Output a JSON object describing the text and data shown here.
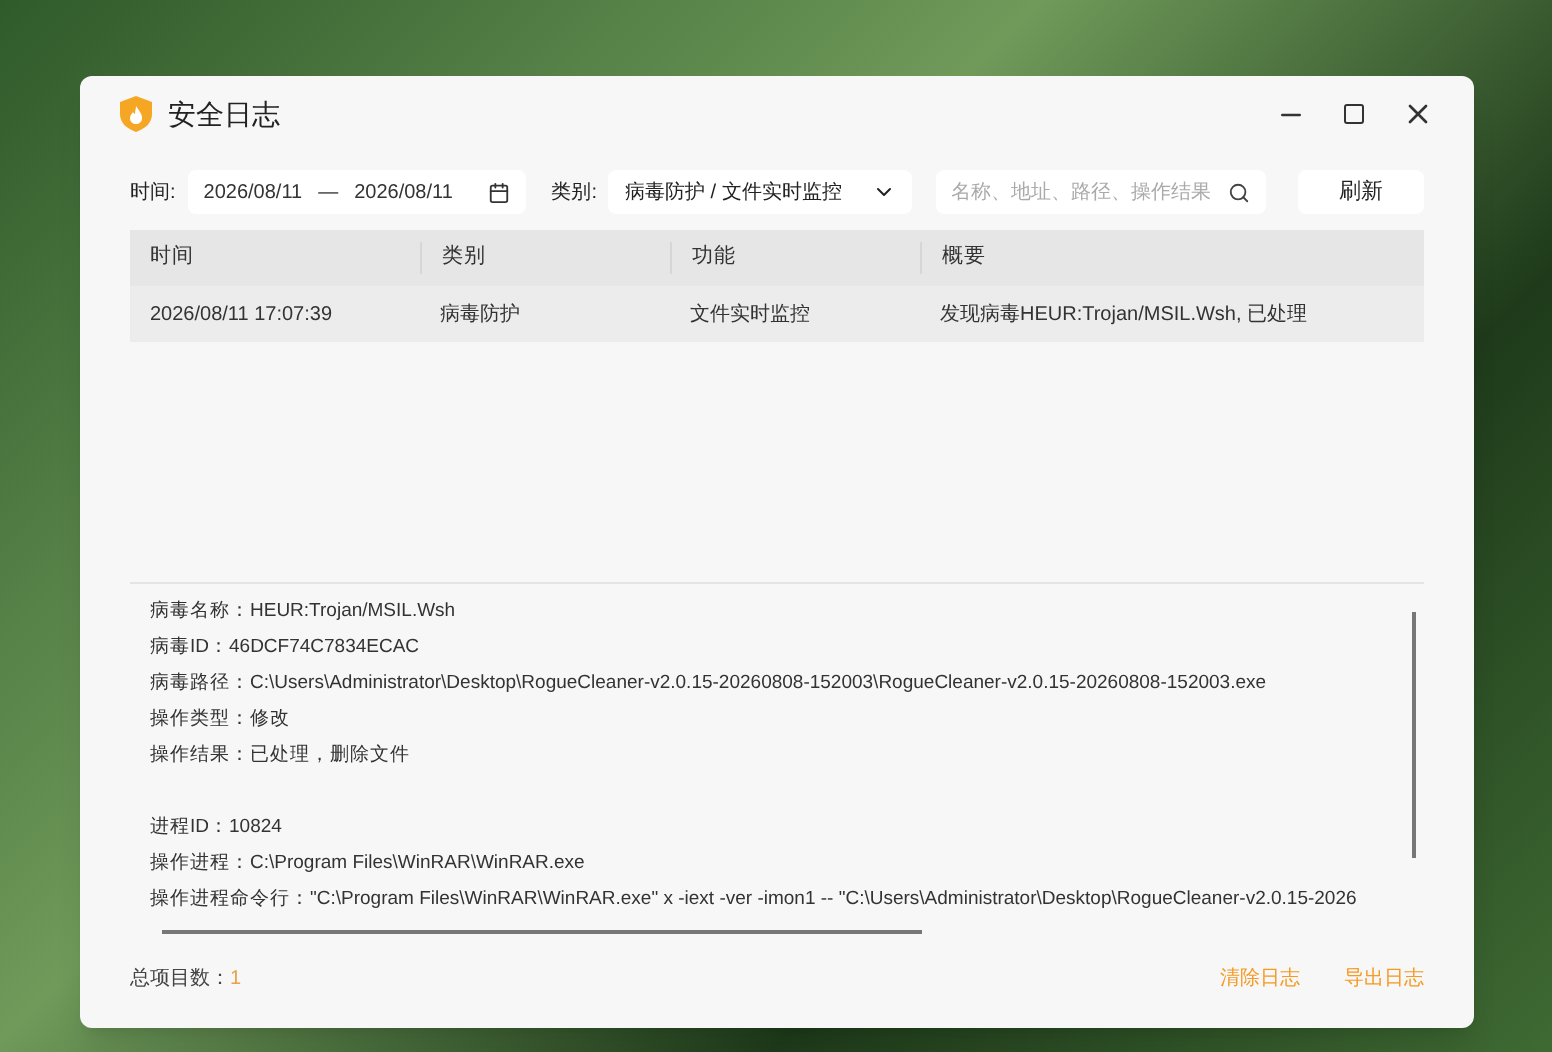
{
  "window": {
    "title": "安全日志"
  },
  "filters": {
    "time_label": "时间:",
    "date_from": "2026/08/11",
    "date_sep": "—",
    "date_to": "2026/08/11",
    "category_label": "类别:",
    "category_value": "病毒防护 / 文件实时监控",
    "search": {
      "placeholder": "名称、地址、路径、操作结果"
    },
    "refresh": "刷新"
  },
  "table": {
    "columns": [
      "时间",
      "类别",
      "功能",
      "概要"
    ],
    "rows": [
      {
        "selected": true,
        "cells": [
          "2026/08/11 17:07:39",
          "病毒防护",
          "文件实时监控",
          "发现病毒HEUR:Trojan/MSIL.Wsh, 已处理"
        ]
      }
    ]
  },
  "details": [
    [
      "病毒名称：HEUR:Trojan/MSIL.Wsh",
      "病毒ID：46DCF74C7834ECAC",
      "病毒路径：C:\\Users\\Administrator\\Desktop\\RogueCleaner-v2.0.15-20260808-152003\\RogueCleaner-v2.0.15-20260808-152003.exe",
      "操作类型：修改",
      "操作结果：已处理，删除文件"
    ],
    [
      "进程ID：10824",
      "操作进程：C:\\Program Files\\WinRAR\\WinRAR.exe",
      "操作进程命令行：\"C:\\Program Files\\WinRAR\\WinRAR.exe\" x -iext -ver -imon1 -- \"C:\\Users\\Administrator\\Desktop\\RogueCleaner-v2.0.15-2026"
    ]
  ],
  "footer": {
    "count_label": "总项目数：",
    "count": "1",
    "actions": [
      "清除日志",
      "导出日志"
    ]
  }
}
